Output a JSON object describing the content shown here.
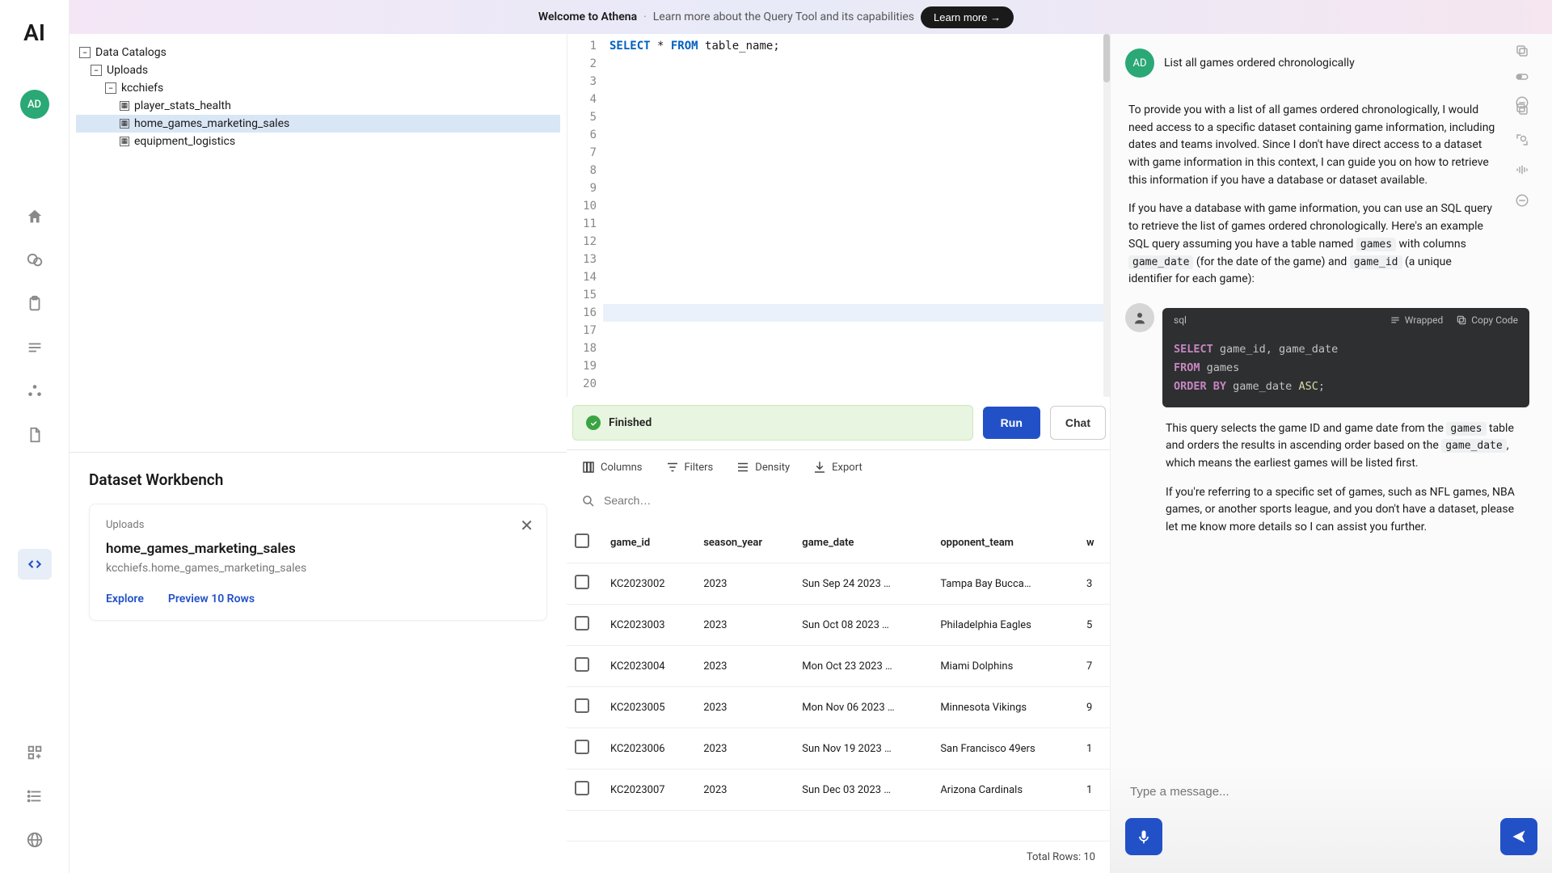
{
  "banner": {
    "title": "Welcome to Athena",
    "text": "Learn more about the Query Tool and its capabilities",
    "button": "Learn more →"
  },
  "rail": {
    "logo": "AI",
    "avatar": "AD"
  },
  "tree": {
    "root": "Data Catalogs",
    "uploads": "Uploads",
    "schema": "kcchiefs",
    "tables": [
      "player_stats_health",
      "home_games_marketing_sales",
      "equipment_logistics"
    ],
    "selected_index": 1
  },
  "workbench": {
    "title": "Dataset Workbench",
    "uploads_label": "Uploads",
    "name": "home_games_marketing_sales",
    "path": "kcchiefs.home_games_marketing_sales",
    "explore": "Explore",
    "preview": "Preview 10 Rows"
  },
  "editor": {
    "line_count": 20,
    "active_line": 16,
    "code_kw_select": "SELECT",
    "code_star": " * ",
    "code_kw_from": "FROM",
    "code_rest": " table_name;"
  },
  "runbar": {
    "status": "Finished",
    "run": "Run",
    "chat": "Chat"
  },
  "grid": {
    "tools": {
      "columns": "Columns",
      "filters": "Filters",
      "density": "Density",
      "export": "Export"
    },
    "search_placeholder": "Search…",
    "headers": [
      "game_id",
      "season_year",
      "game_date",
      "opponent_team",
      "w"
    ],
    "rows": [
      {
        "game_id": "KC2023002",
        "season_year": "2023",
        "game_date": "Sun Sep 24 2023 …",
        "opponent_team": "Tampa Bay Bucca…",
        "w": "3"
      },
      {
        "game_id": "KC2023003",
        "season_year": "2023",
        "game_date": "Sun Oct 08 2023 …",
        "opponent_team": "Philadelphia Eagles",
        "w": "5"
      },
      {
        "game_id": "KC2023004",
        "season_year": "2023",
        "game_date": "Mon Oct 23 2023 …",
        "opponent_team": "Miami Dolphins",
        "w": "7"
      },
      {
        "game_id": "KC2023005",
        "season_year": "2023",
        "game_date": "Mon Nov 06 2023 …",
        "opponent_team": "Minnesota Vikings",
        "w": "9"
      },
      {
        "game_id": "KC2023006",
        "season_year": "2023",
        "game_date": "Sun Nov 19 2023 …",
        "opponent_team": "San Francisco 49ers",
        "w": "1"
      },
      {
        "game_id": "KC2023007",
        "season_year": "2023",
        "game_date": "Sun Dec 03 2023 …",
        "opponent_team": "Arizona Cardinals",
        "w": "1"
      }
    ],
    "footer": "Total Rows: 10"
  },
  "chat": {
    "user_avatar": "AD",
    "user_text": "List all games ordered chronologically",
    "ai": {
      "p1": "To provide you with a list of all games ordered chronologically, I would need access to a specific dataset containing game information, including dates and teams involved. Since I don't have direct access to a dataset with game information in this context, I can guide you on how to retrieve this information if you have a database or dataset available.",
      "p2_a": "If you have a database with game information, you can use an SQL query to retrieve the list of games ordered chronologically. Here's an example SQL query assuming you have a table named ",
      "p2_code1": "games",
      "p2_b": " with columns ",
      "p2_code2": "game_date",
      "p2_c": " (for the date of the game) and ",
      "p2_code3": "game_id",
      "p2_d": " (a unique identifier for each game):",
      "code_lang": "sql",
      "wrapped": "Wrapped",
      "copy": "Copy Code",
      "sql": {
        "l1_kw": "SELECT",
        "l1_rest": " game_id, game_date",
        "l2_kw": "FROM",
        "l2_rest": " games",
        "l3_kw": "ORDER BY",
        "l3_mid": " game_date ",
        "l3_asc": "ASC",
        "l3_end": ";"
      },
      "p3_a": "This query selects the game ID and game date from the ",
      "p3_code1": "games",
      "p3_b": " table and orders the results in ascending order based on the ",
      "p3_code2": "game_date",
      "p3_c": ", which means the earliest games will be listed first.",
      "p4": "If you're referring to a specific set of games, such as NFL games, NBA games, or another sports league, and you don't have a dataset, please let me know more details so I can assist you further."
    },
    "input_placeholder": "Type a message..."
  }
}
